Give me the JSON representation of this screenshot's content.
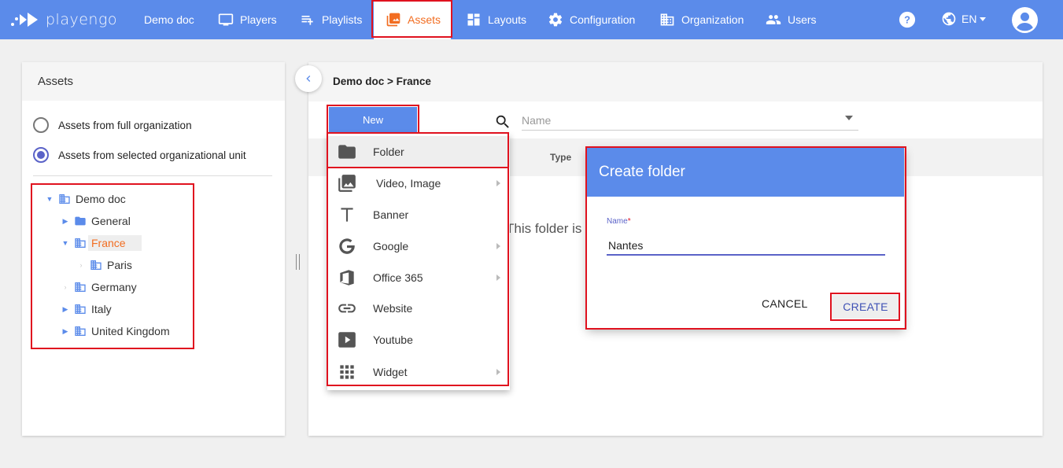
{
  "app": {
    "logo_text": "playengo"
  },
  "nav": {
    "items": [
      {
        "label": "Demo doc",
        "icon": "none"
      },
      {
        "label": "Players",
        "icon": "monitor-icon"
      },
      {
        "label": "Playlists",
        "icon": "playlist-icon"
      },
      {
        "label": "Assets",
        "icon": "image-icon",
        "active": true
      },
      {
        "label": "Layouts",
        "icon": "layout-icon"
      },
      {
        "label": "Configuration",
        "icon": "gear-icon"
      },
      {
        "label": "Organization",
        "icon": "building-icon"
      },
      {
        "label": "Users",
        "icon": "users-icon"
      }
    ],
    "language": "EN"
  },
  "left_panel": {
    "title": "Assets",
    "radio_full": "Assets from full organization",
    "radio_selected": "Assets from selected organizational unit",
    "selected_radio": "selected",
    "tree": [
      {
        "label": "Demo doc",
        "expanded": true
      },
      {
        "label": "General"
      },
      {
        "label": "France",
        "expanded": true,
        "selected": true
      },
      {
        "label": "Paris"
      },
      {
        "label": "Germany"
      },
      {
        "label": "Italy"
      },
      {
        "label": "United Kingdom"
      }
    ]
  },
  "main": {
    "breadcrumb": "Demo doc > France",
    "new_button": "New",
    "search_placeholder": "Name",
    "type_column": "Type",
    "empty_message": "This folder is"
  },
  "menu": {
    "items": [
      {
        "label": "Folder",
        "icon": "folder-icon"
      },
      {
        "label": "Video, Image",
        "icon": "photo-library-icon",
        "submenu": true
      },
      {
        "label": "Banner",
        "icon": "text-icon"
      },
      {
        "label": "Google",
        "icon": "google-icon",
        "submenu": true
      },
      {
        "label": "Office 365",
        "icon": "office-icon",
        "submenu": true
      },
      {
        "label": "Website",
        "icon": "link-icon"
      },
      {
        "label": "Youtube",
        "icon": "youtube-icon"
      },
      {
        "label": "Widget",
        "icon": "apps-grid-icon",
        "submenu": true
      }
    ]
  },
  "dialog": {
    "title": "Create folder",
    "field_label": "Name",
    "required_mark": "*",
    "field_value": "Nantes",
    "cancel_label": "CANCEL",
    "create_label": "CREATE"
  },
  "colors": {
    "primary": "#5b8bea",
    "accent_orange": "#f26d21",
    "highlight_red": "#e0121f",
    "indigo": "#5b63c8"
  }
}
